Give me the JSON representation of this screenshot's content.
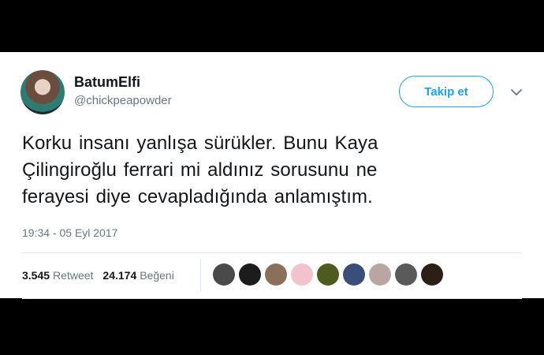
{
  "author": {
    "name": "BatumElfi",
    "handle": "@chickpeapowder"
  },
  "actions": {
    "follow_label": "Takip et",
    "more_icon": "chevron-down-icon"
  },
  "tweet": {
    "text": "Korku insanı yanlışa sürükler. Bunu Kaya\nÇilingiroğlu ferrari mi aldınız sorusunu ne\nferayesi diye cevapladığında anlamıştım.",
    "timestamp": "19:34 - 05 Eyl 2017"
  },
  "stats": {
    "retweet_count": "3.545",
    "retweet_label": "Retweet",
    "like_count": "24.174",
    "like_label": "Beğeni"
  },
  "likers": [
    {
      "name": "liker-avatar-1",
      "color": "#4a4a4a"
    },
    {
      "name": "liker-avatar-2",
      "color": "#1c1c1c"
    },
    {
      "name": "liker-avatar-3",
      "color": "#8a6f5a"
    },
    {
      "name": "liker-avatar-4",
      "color": "#f3c2cf"
    },
    {
      "name": "liker-avatar-5",
      "color": "#4d5c1e"
    },
    {
      "name": "liker-avatar-6",
      "color": "#3b4e7a"
    },
    {
      "name": "liker-avatar-7",
      "color": "#b9a6a4"
    },
    {
      "name": "liker-avatar-8",
      "color": "#5a5a5a"
    },
    {
      "name": "liker-avatar-9",
      "color": "#2b1f16"
    }
  ],
  "colors": {
    "accent": "#1da1f2",
    "text": "#14171a",
    "muted": "#657786"
  }
}
